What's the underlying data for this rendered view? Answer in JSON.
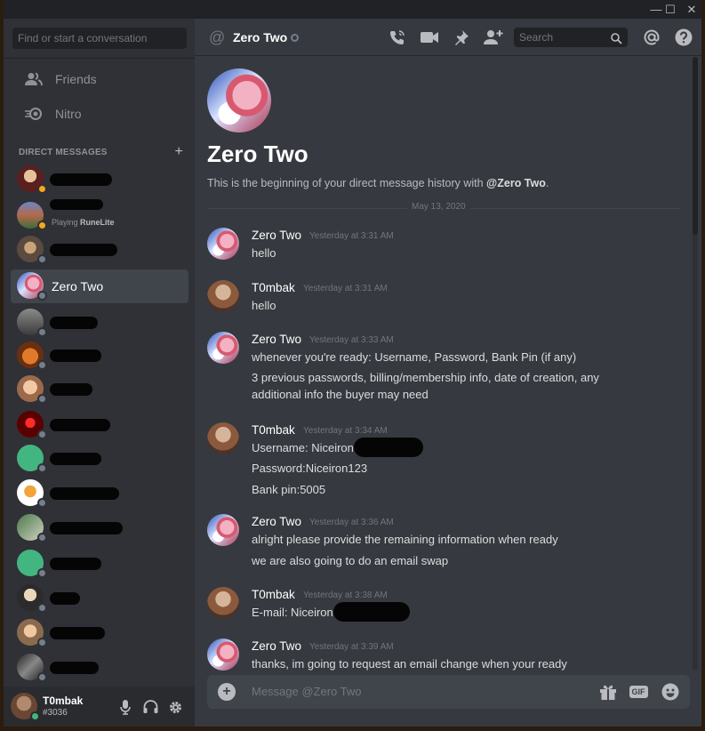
{
  "window": {
    "minimize_icon": "minimize-icon",
    "maximize_icon": "maximize-icon",
    "close_icon": "close-icon"
  },
  "sidebar": {
    "search_placeholder": "Find or start a conversation",
    "nav": [
      {
        "label": "Friends",
        "icon": "friends-icon"
      },
      {
        "label": "Nitro",
        "icon": "nitro-icon"
      }
    ],
    "dm_header": "DIRECT MESSAGES",
    "dm_add_icon": "plus-icon",
    "dms": [
      {
        "name": "",
        "status": "idle",
        "activity_prefix": "",
        "activity": ""
      },
      {
        "name": "",
        "status": "idle",
        "activity_prefix": "Playing",
        "activity": "RuneLite"
      },
      {
        "name": "",
        "status": "offline",
        "activity_prefix": "",
        "activity": ""
      },
      {
        "name": "Zero Two",
        "status": "offline",
        "activity_prefix": "",
        "activity": ""
      },
      {
        "name": "",
        "status": "offline",
        "activity_prefix": "",
        "activity": ""
      },
      {
        "name": "",
        "status": "offline",
        "activity_prefix": "",
        "activity": ""
      },
      {
        "name": "",
        "status": "offline",
        "activity_prefix": "",
        "activity": ""
      },
      {
        "name": "",
        "status": "offline",
        "activity_prefix": "",
        "activity": ""
      },
      {
        "name": "",
        "status": "offline",
        "activity_prefix": "",
        "activity": ""
      },
      {
        "name": "",
        "status": "offline",
        "activity_prefix": "",
        "activity": ""
      },
      {
        "name": "",
        "status": "offline",
        "activity_prefix": "",
        "activity": ""
      },
      {
        "name": "",
        "status": "offline",
        "activity_prefix": "",
        "activity": ""
      },
      {
        "name": "",
        "status": "offline",
        "activity_prefix": "",
        "activity": ""
      },
      {
        "name": "",
        "status": "offline",
        "activity_prefix": "",
        "activity": ""
      },
      {
        "name": "",
        "status": "offline",
        "activity_prefix": "",
        "activity": ""
      }
    ],
    "user": {
      "name": "T0mbak",
      "tag": "#3036",
      "status": "online"
    }
  },
  "header": {
    "title": "Zero Two",
    "search_placeholder": "Search",
    "icons": [
      "call-icon",
      "video-icon",
      "pin-icon",
      "add-friend-icon",
      "mention-icon",
      "help-icon"
    ]
  },
  "intro": {
    "title": "Zero Two",
    "desc_prefix": "This is the beginning of your direct message history with ",
    "desc_name": "@Zero Two",
    "desc_suffix": "."
  },
  "date_divider": "May 13, 2020",
  "messages": [
    {
      "author": "Zero Two",
      "time": "Yesterday at 3:31 AM",
      "lines": [
        "hello"
      ]
    },
    {
      "author": "T0mbak",
      "time": "Yesterday at 3:31 AM",
      "lines": [
        "hello"
      ]
    },
    {
      "author": "Zero Two",
      "time": "Yesterday at 3:33 AM",
      "lines": [
        "whenever you're ready: Username, Password, Bank Pin (if any)",
        "3 previous passwords, billing/membership info, date of creation, any additional info the buyer may need"
      ]
    },
    {
      "author": "T0mbak",
      "time": "Yesterday at 3:34 AM",
      "lines": [
        "Username: Niceiron",
        "Password:Niceiron123",
        "Bank pin:5005"
      ]
    },
    {
      "author": "Zero Two",
      "time": "Yesterday at 3:36 AM",
      "lines": [
        "alright please provide the remaining information when ready",
        "we are also going to do an email swap"
      ]
    },
    {
      "author": "T0mbak",
      "time": "Yesterday at 3:38 AM",
      "lines": [
        "E-mail: Niceiron"
      ]
    },
    {
      "author": "Zero Two",
      "time": "Yesterday at 3:39 AM",
      "lines": [
        "thanks, im going to request an email change when your ready"
      ]
    }
  ],
  "composer": {
    "placeholder": "Message @Zero Two",
    "gif_label": "GIF",
    "icons": [
      "attach-plus-icon",
      "gift-icon",
      "gif-icon",
      "emoji-icon"
    ]
  }
}
